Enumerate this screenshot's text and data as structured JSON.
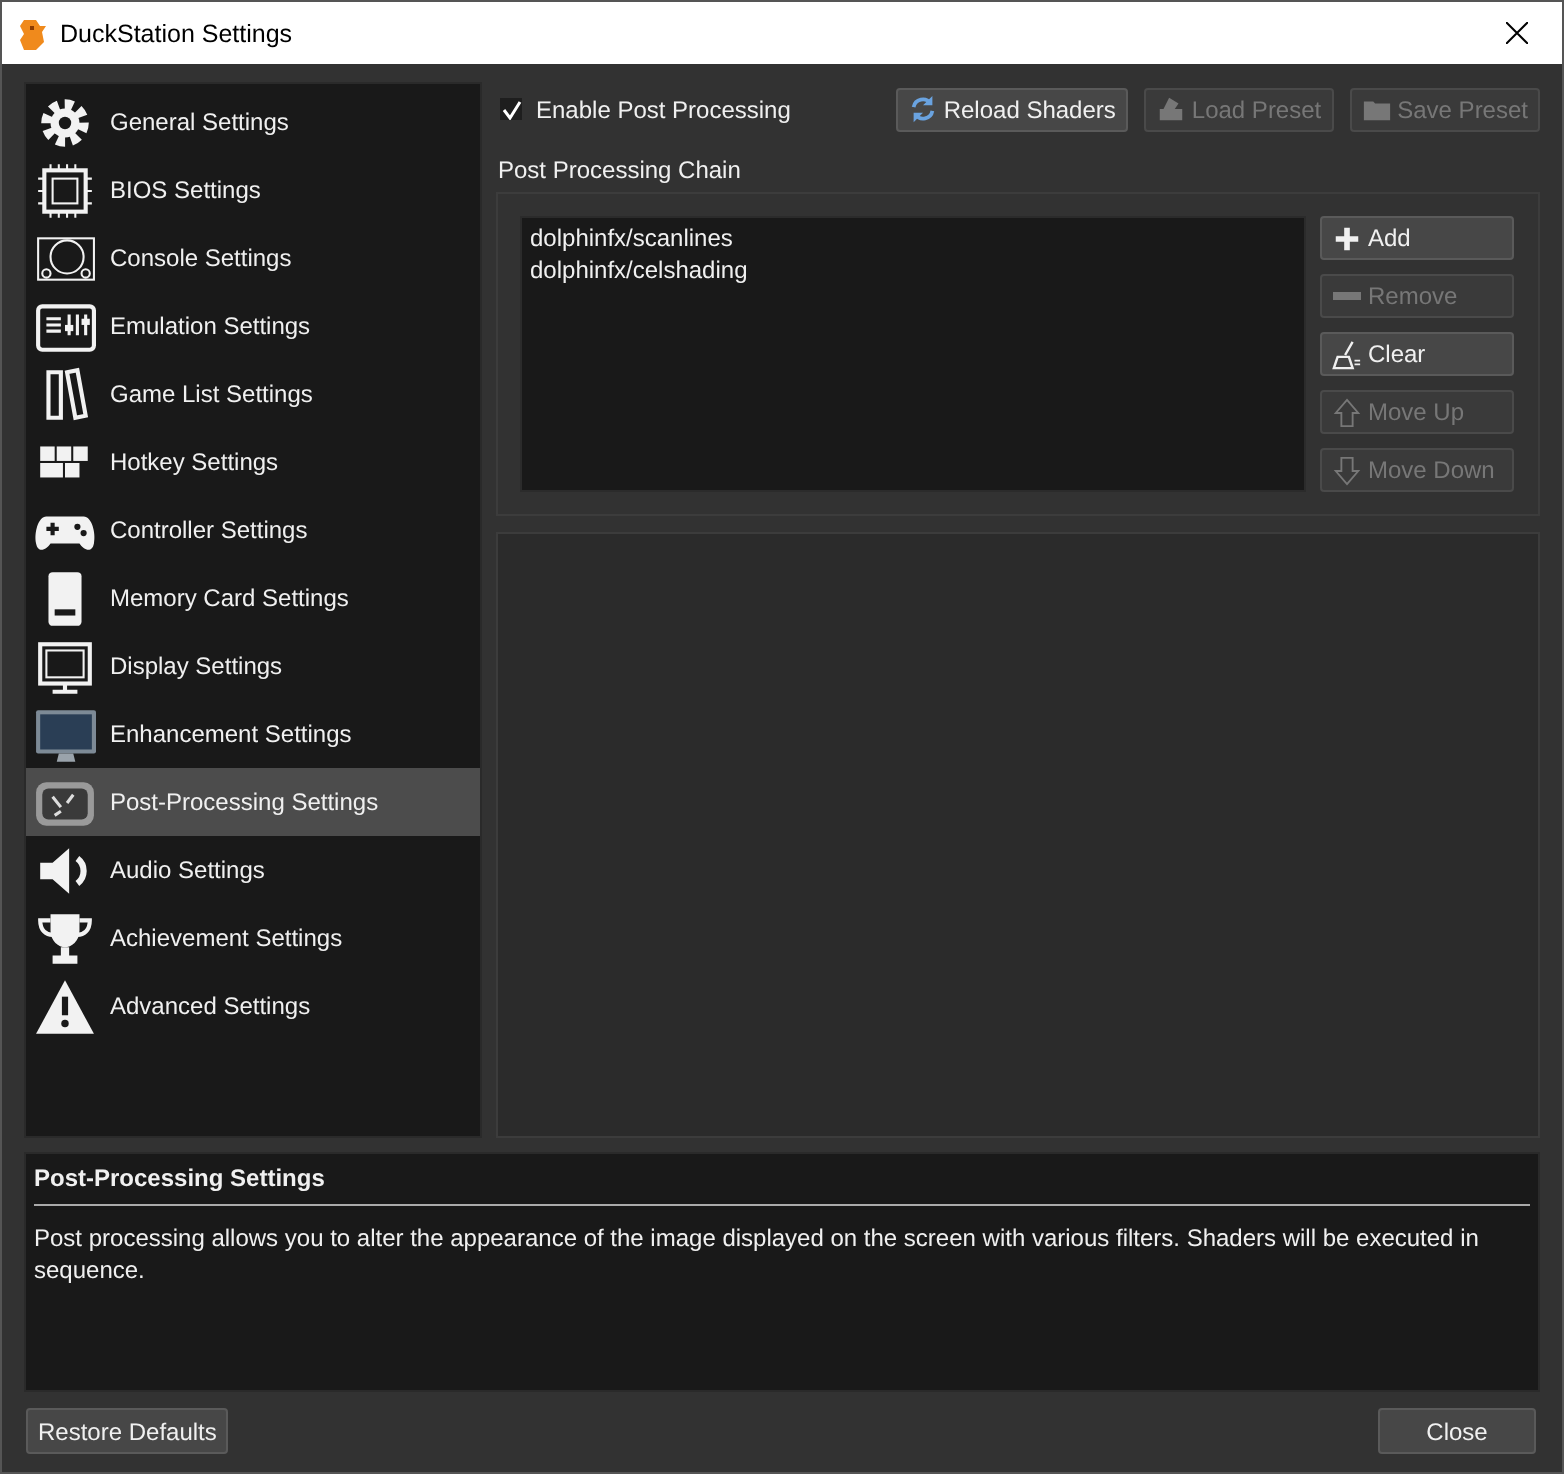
{
  "window": {
    "title": "DuckStation Settings"
  },
  "sidebar": {
    "items": [
      {
        "label": "General Settings",
        "kind": "gear",
        "selected": false
      },
      {
        "label": "BIOS Settings",
        "kind": "chip",
        "selected": false
      },
      {
        "label": "Console Settings",
        "kind": "console",
        "selected": false
      },
      {
        "label": "Emulation Settings",
        "kind": "sliders",
        "selected": false
      },
      {
        "label": "Game List Settings",
        "kind": "books",
        "selected": false
      },
      {
        "label": "Hotkey Settings",
        "kind": "keys",
        "selected": false
      },
      {
        "label": "Controller Settings",
        "kind": "gamepad",
        "selected": false
      },
      {
        "label": "Memory Card Settings",
        "kind": "card",
        "selected": false
      },
      {
        "label": "Display Settings",
        "kind": "display",
        "selected": false
      },
      {
        "label": "Enhancement Settings",
        "kind": "monitor",
        "selected": false
      },
      {
        "label": "Post-Processing Settings",
        "kind": "effects",
        "selected": true
      },
      {
        "label": "Audio Settings",
        "kind": "speaker",
        "selected": false
      },
      {
        "label": "Achievement Settings",
        "kind": "trophy",
        "selected": false
      },
      {
        "label": "Advanced Settings",
        "kind": "warning",
        "selected": false
      }
    ]
  },
  "post_processing": {
    "enable": {
      "label": "Enable Post Processing",
      "checked": true
    },
    "top_buttons": [
      {
        "label": "Reload Shaders",
        "kind": "reload",
        "disabled": false
      },
      {
        "label": "Load Preset",
        "kind": "load",
        "disabled": true
      },
      {
        "label": "Save Preset",
        "kind": "folder",
        "disabled": true
      }
    ],
    "chain_label": "Post Processing Chain",
    "chain": [
      {
        "name": "dolphinfx/scanlines",
        "selected": false
      },
      {
        "name": "dolphinfx/celshading",
        "selected": false
      }
    ],
    "chain_buttons": [
      {
        "label": "Add",
        "kind": "plus",
        "disabled": false
      },
      {
        "label": "Remove",
        "kind": "minus",
        "disabled": true
      },
      {
        "label": "Clear",
        "kind": "broom",
        "disabled": false
      },
      {
        "label": "Move Up",
        "kind": "up",
        "disabled": true
      },
      {
        "label": "Move Down",
        "kind": "down",
        "disabled": true
      }
    ]
  },
  "description": {
    "title": "Post-Processing Settings",
    "text": "Post processing allows you to alter the appearance of the image displayed on the screen with various filters. Shaders will be executed in sequence."
  },
  "footer": {
    "restore": "Restore Defaults",
    "close": "Close"
  }
}
